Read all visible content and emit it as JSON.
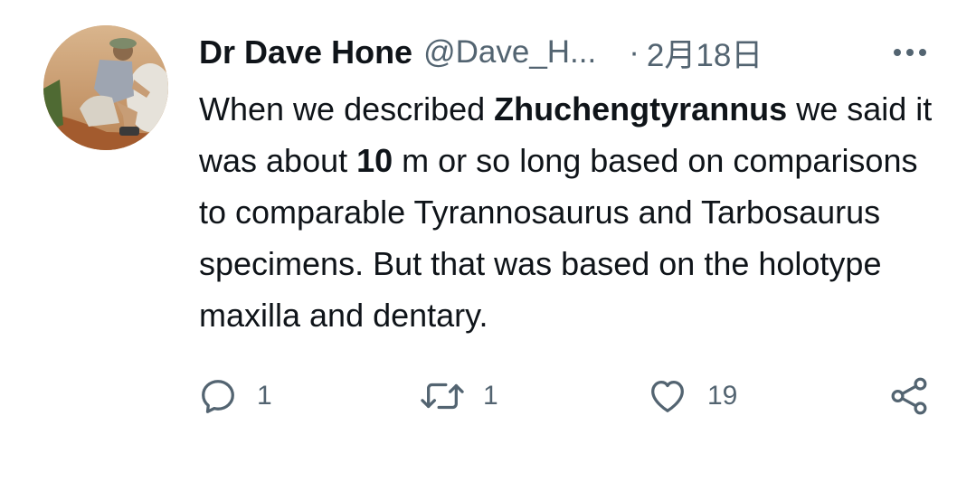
{
  "tweet": {
    "author": {
      "display_name": "Dr Dave Hone",
      "handle": "@Dave_H...",
      "avatar_icon": "profile-photo"
    },
    "separator": "·",
    "timestamp": "2月18日",
    "more_icon": "more-horizontal-icon",
    "text": {
      "segment_1": "When we described ",
      "taxon": "Zhuchengtyrannus",
      "segment_2": " we said it was about ",
      "length_value": "10",
      "segment_3": " m or so long based on comparisons to comparable Tyrannosaurus and Tarbosaurus specimens. But that was based on the holotype maxilla and dentary."
    },
    "actions": {
      "reply_count": "1",
      "retweet_count": "1",
      "like_count": "19"
    },
    "colors": {
      "primary_text": "#0f1419",
      "secondary_text": "#536471",
      "background": "#ffffff"
    }
  }
}
